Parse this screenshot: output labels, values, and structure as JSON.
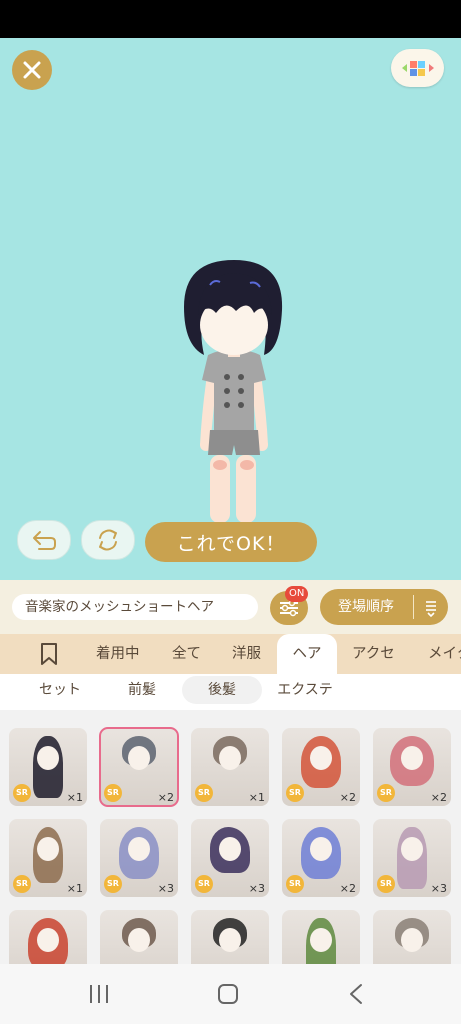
{
  "colors": {
    "stage": "#a6e5e3",
    "gold": "#c9a24f",
    "badge_red": "#e74a3b",
    "tab_bg": "#f1ddc0"
  },
  "controls": {
    "ok_label": "これでOK！"
  },
  "filter_bar": {
    "item_name": "音楽家のメッシュショートヘア",
    "filter_badge": "ON",
    "sort_label": "登場順序"
  },
  "tabs": [
    {
      "label": "着用中"
    },
    {
      "label": "全て"
    },
    {
      "label": "洋服"
    },
    {
      "label": "ヘア",
      "active": true
    },
    {
      "label": "アクセ"
    },
    {
      "label": "メイク"
    }
  ],
  "subtabs": [
    {
      "label": "セット"
    },
    {
      "label": "前髪"
    },
    {
      "label": "後髪",
      "active": true
    },
    {
      "label": "エクステ"
    }
  ],
  "items": [
    {
      "rarity": "SR",
      "count": "×1",
      "hair_color": "#1d1b2a",
      "style": "long"
    },
    {
      "rarity": "SR",
      "count": "×2",
      "hair_color": "#5c6370",
      "style": "short",
      "selected": true
    },
    {
      "rarity": "SR",
      "count": "×1",
      "hair_color": "#7a6a5e",
      "style": "short"
    },
    {
      "rarity": "SR",
      "count": "×2",
      "hair_color": "#d4553a",
      "style": "wavy"
    },
    {
      "rarity": "SR",
      "count": "×2",
      "hair_color": "#d2707a",
      "style": "twin"
    },
    {
      "rarity": "SR",
      "count": "×1",
      "hair_color": "#8d6c4e",
      "style": "braid"
    },
    {
      "rarity": "SR",
      "count": "×3",
      "hair_color": "#8a8fc5",
      "style": "wavy"
    },
    {
      "rarity": "SR",
      "count": "×3",
      "hair_color": "#3b2f5c",
      "style": "ponytail"
    },
    {
      "rarity": "SR",
      "count": "×2",
      "hair_color": "#6f7fd6",
      "style": "wavy"
    },
    {
      "rarity": "SR",
      "count": "×3",
      "hair_color": "#b79ab3",
      "style": "long"
    },
    {
      "hair_color": "#c9432f",
      "style": "wavy"
    },
    {
      "hair_color": "#6e5b4e",
      "style": "short"
    },
    {
      "hair_color": "#222222",
      "style": "short"
    },
    {
      "hair_color": "#5e8a3e",
      "style": "long"
    },
    {
      "hair_color": "#8a7f75",
      "style": "short"
    }
  ]
}
